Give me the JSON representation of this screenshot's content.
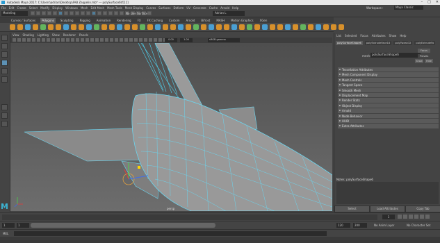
{
  "titlebar": {
    "title": "Autodesk Maya 2017: C:\\Users\\adrian\\Desktop\\FAB Zeppelin.mb* --- polySurface6\\f[11]",
    "minimize": "–",
    "maximize": "□",
    "close": "✕"
  },
  "menubar": {
    "items": [
      "File",
      "Edit",
      "Create",
      "Select",
      "Modify",
      "Display",
      "Windows",
      "Mesh",
      "Edit Mesh",
      "Mesh Tools",
      "Mesh Display",
      "Curves",
      "Surfaces",
      "Deform",
      "UV",
      "Generate",
      "Cache",
      "Arnold",
      "Help"
    ],
    "workspace_label": "Workspace :",
    "workspace_value": "Maya Classic"
  },
  "statusline": {
    "mode": "Modeling",
    "no_live_surface": "No Live Surface",
    "user": "Adrian L",
    "symmetry": "Symmetry: Off"
  },
  "shelf": {
    "tabs": [
      "Curves / Surfaces",
      "Polygons",
      "Sculpting",
      "Rigging",
      "Animation",
      "Rendering",
      "FX",
      "FX Caching",
      "Custom",
      "Arnold",
      "Bifrost",
      "MASH",
      "Motion Graphics",
      "XGen"
    ],
    "active_tab": "Polygons"
  },
  "viewport": {
    "menus": [
      "View",
      "Shading",
      "Lighting",
      "Show",
      "Renderer",
      "Panels"
    ],
    "gamma_value1": "0.00",
    "gamma_value2": "1.00",
    "color_space": "sRGB gamma",
    "camera_label": "persp",
    "accent_wire": "#6ad6f0",
    "axis_colors": {
      "x": "#e23c3c",
      "y": "#4ad14a",
      "z": "#3c6ef0"
    }
  },
  "toolbox": {
    "logo": "M"
  },
  "attribute_editor": {
    "menus": [
      "List",
      "Selected",
      "Focus",
      "Attributes",
      "Show",
      "Help"
    ],
    "node_tabs": [
      "polySurfaceShape6",
      "polyExtrudeFace18",
      "polyTweak32",
      "polyExtrudeFa"
    ],
    "active_node_tab": "polySurfaceShape6",
    "mesh_label": "mesh:",
    "mesh_value": "polySurfaceShape6",
    "focus_button": "Focus",
    "presets_button": "Presets",
    "show_button": "Show",
    "hide_button": "Hide",
    "sections": [
      "Tessellation Attributes",
      "Mesh Component Display",
      "Mesh Controls",
      "Tangent Space",
      "Smooth Mesh",
      "Displacement Map",
      "Render Stats",
      "Object Display",
      "Arnold",
      "Node Behavior",
      "UUID",
      "Extra Attributes"
    ],
    "notes_label": "Notes:  polySurfaceShape6",
    "select_button": "Select",
    "load_attributes_button": "Load Attributes",
    "copy_tab_button": "Copy Tab"
  },
  "timeslider": {
    "ticks": [
      "1",
      "5",
      "10",
      "15",
      "20",
      "25",
      "30",
      "35",
      "40",
      "45",
      "50",
      "55",
      "60",
      "65",
      "70",
      "75",
      "80",
      "85",
      "90",
      "95",
      "100",
      "105",
      "110",
      "115",
      "120"
    ],
    "current_frame": "1"
  },
  "rangeslider": {
    "start": "1",
    "start_inner": "1",
    "range_end_label": "120",
    "end_inner": "120",
    "end": "200",
    "anim_layer": "No Anim Layer",
    "char_set": "No Character Set"
  },
  "cmdline": {
    "label": "MEL"
  }
}
